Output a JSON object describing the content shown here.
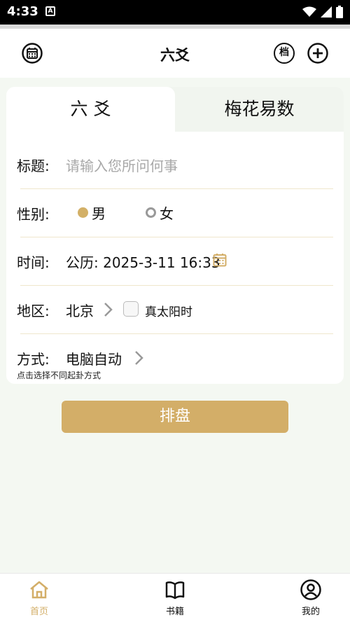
{
  "status_bar": {
    "time": "4:33",
    "notification_glyph": "A"
  },
  "header": {
    "title": "六爻",
    "archive_label": "档"
  },
  "tabs": [
    {
      "label": "六 爻",
      "active": true
    },
    {
      "label": "梅花易数",
      "active": false
    }
  ],
  "form": {
    "title_label": "标题:",
    "title_placeholder": "请输入您所问何事",
    "gender_label": "性别:",
    "gender_options": [
      {
        "label": "男",
        "selected": true
      },
      {
        "label": "女",
        "selected": false
      }
    ],
    "time_label": "时间:",
    "time_value": "公历: 2025-3-11 16:33",
    "region_label": "地区:",
    "region_value": "北京",
    "true_solar_label": "真太阳时",
    "true_solar_checked": false,
    "method_label": "方式:",
    "method_value": "电脑自动",
    "method_hint": "点击选择不同起卦方式"
  },
  "submit_label": "排盘",
  "bottom_nav": [
    {
      "label": "首页",
      "icon": "home-icon",
      "active": true
    },
    {
      "label": "书籍",
      "icon": "book-icon",
      "active": false
    },
    {
      "label": "我的",
      "icon": "user-icon",
      "active": false
    }
  ],
  "colors": {
    "accent": "#d3ae68",
    "background": "#f4f8f2",
    "divider": "#efe6cc"
  }
}
